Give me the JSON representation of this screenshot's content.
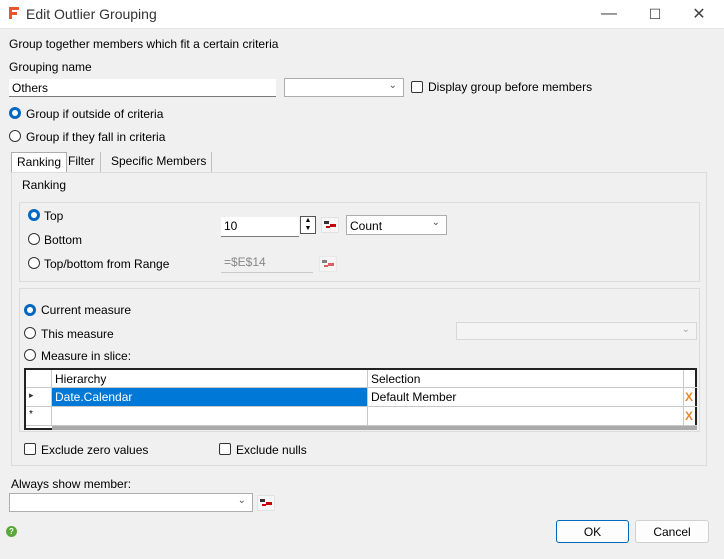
{
  "window": {
    "title": "Edit Outlier Grouping",
    "minimize": "—",
    "maximize": "☐",
    "close": "✕"
  },
  "intro": "Group together members which fit a certain criteria",
  "grouping_name_label": "Grouping name",
  "grouping_name_value": "Others",
  "display_before_label": "Display group before members",
  "radio_outside": "Group if outside of criteria",
  "radio_inside": "Group if they fall in criteria",
  "tabs": [
    "Ranking",
    "Filter",
    "Specific Members"
  ],
  "ranking_group_label": "Ranking",
  "top_label": "Top",
  "bottom_label": "Bottom",
  "range_label": "Top/bottom from Range",
  "top_value": "10",
  "range_value": "=$E$14",
  "count_option": "Count",
  "current_measure": "Current measure",
  "this_measure": "This measure",
  "measure_in_slice": "Measure in slice:",
  "grid": {
    "headers": [
      "Hierarchy",
      "Selection"
    ],
    "rows": [
      {
        "marker": "▸",
        "hierarchy": "Date.Calendar",
        "selection": "Default Member",
        "delete": "X"
      },
      {
        "marker": "*",
        "hierarchy": "",
        "selection": "",
        "delete": "X"
      }
    ]
  },
  "exclude_zero": "Exclude zero values",
  "exclude_nulls": "Exclude nulls",
  "always_show_label": "Always show member:",
  "ok": "OK",
  "cancel": "Cancel",
  "colors": {
    "accent": "#0067c0",
    "selected_row": "#0078d7",
    "logo": "#e8562a"
  }
}
